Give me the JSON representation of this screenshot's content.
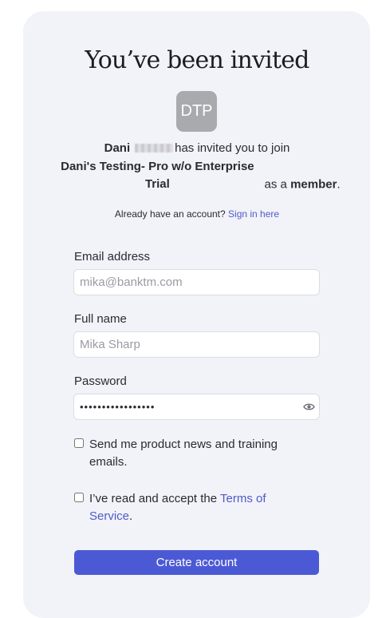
{
  "title": "You’ve been invited",
  "avatar": {
    "initials": "DTP"
  },
  "invite": {
    "inviter_first_name": "Dani",
    "text_mid": "has invited you to join",
    "org_name": "Dani's Testing- Pro w/o Enterprise Trial",
    "text_role_prefix": "as a",
    "role": "member",
    "text_end": "."
  },
  "signin": {
    "prompt": "Already have an account?",
    "link_label": "Sign in here"
  },
  "form": {
    "email": {
      "label": "Email address",
      "placeholder": "mika@banktm.com",
      "value": ""
    },
    "fullname": {
      "label": "Full name",
      "placeholder": "Mika Sharp",
      "value": ""
    },
    "password": {
      "label": "Password",
      "value": "•••••••••••••••••",
      "reveal_icon": "eye-icon"
    },
    "news_checkbox": {
      "label": "Send me product news and training emails.",
      "checked": false
    },
    "terms_checkbox": {
      "label_prefix": "I’ve read and accept the",
      "link_label": "Terms of Service",
      "label_suffix": ".",
      "checked": false
    },
    "submit_label": "Create account"
  },
  "colors": {
    "card_bg": "#f2f2f9",
    "accent": "#4b5ad4",
    "link": "#4d5cc7",
    "avatar_bg": "#a9aaae"
  }
}
